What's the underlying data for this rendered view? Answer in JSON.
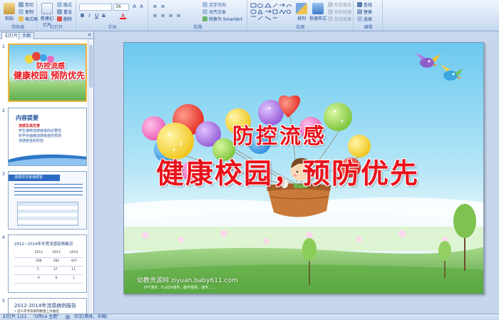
{
  "ribbon": {
    "clipboard": {
      "paste": "粘贴",
      "cut": "剪切",
      "copy": "复制",
      "format_painter": "格式刷",
      "label": "剪贴板"
    },
    "slides": {
      "new_slide": "新建幻灯片",
      "layout": "版式",
      "reset": "重设",
      "delete": "删除",
      "label": "幻灯片"
    },
    "font": {
      "font_name": "",
      "font_size": "36",
      "label": "字体"
    },
    "paragraph": {
      "text_direction": "文字方向",
      "align_text": "对齐文本",
      "smartart": "转换为 SmartArt",
      "label": "段落"
    },
    "drawing": {
      "arrange": "排列",
      "quick_styles": "快速样式",
      "shape_fill": "形状填充",
      "shape_outline": "形状轮廓",
      "shape_effects": "形状效果",
      "label": "绘图"
    },
    "editing": {
      "find": "查找",
      "replace": "替换",
      "select": "选择",
      "label": "编辑"
    }
  },
  "panel": {
    "tab_slides": "幻灯片",
    "tab_outline": "大纲",
    "thumbs": [
      {
        "num": "1",
        "title1": "防控流感",
        "title2": "健康校园 预防优先"
      },
      {
        "num": "2",
        "heading": "内容提要",
        "items": [
          "流感及其危害",
          "学生接种流感疫苗的必要性",
          "科学全面接流感疫苗的预测",
          "流感疫苗的防控"
        ]
      },
      {
        "num": "3",
        "header": "流感并非普通感冒"
      },
      {
        "num": "4",
        "title": "2012~2014年东莞流感疫情概况",
        "cols": [
          "2012",
          "2013",
          "2014"
        ],
        "rows": [
          [
            "",
            "",
            ""
          ],
          [
            "288",
            "282",
            "447"
          ],
          [
            "5",
            "17",
            "11"
          ],
          [
            "0",
            "0",
            "1"
          ]
        ]
      },
      {
        "num": "5",
        "title": "2012-2014年流感病例报告",
        "sub": "• 近三年传染病例数量上升幅度"
      }
    ]
  },
  "slide": {
    "title1": "防控流感",
    "title2": "健康校园，预防优先",
    "watermark": "幼教资源网 ziyuan.baby611.com",
    "watermark_sub": "PPT课件，FLASH课件，教学视频，课件……"
  },
  "status": {
    "slide_count": "幻灯片 1/21",
    "theme": "\"Office 主题\"",
    "language": "中文(简体，中国)"
  },
  "colors": {
    "accent": "#15428b",
    "title_red": "#e8121c",
    "sky": "#6cc9ef",
    "grass": "#7cc35a"
  }
}
